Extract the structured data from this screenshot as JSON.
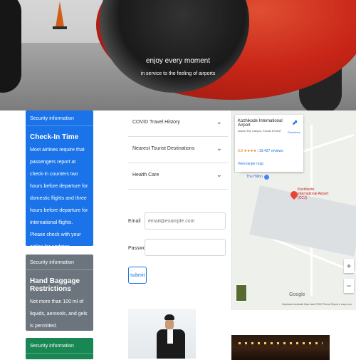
{
  "hero": {
    "headline": "enjoy every moment",
    "subline": "in service to the feeling of airports"
  },
  "cards": [
    {
      "header": "Security information",
      "title": "Check-In Time",
      "text": "Most airlines require that passengers report at check-in counters two hours before departure for domestic flights and three hours before departure for international flights. Please check with your airline for updates.",
      "color": "#1a73e8"
    },
    {
      "header": "Security information",
      "title": "Hand Baggage Restrictions",
      "text": "Not more than 100 ml of liquids, aerosols, and gels is permitted.",
      "color": "#6c757d"
    },
    {
      "header": "Security information",
      "color": "#198754"
    }
  ],
  "accordion": {
    "items": [
      {
        "label": "COVID Travel History"
      },
      {
        "label": "Nearest Tourist Destinations"
      },
      {
        "label": "Health Care"
      }
    ]
  },
  "form": {
    "email_label": "Email",
    "email_placeholder": "email@example.com",
    "password_label": "Password",
    "submit_label": "submit"
  },
  "map": {
    "place_name": "Kozhikode International Airport",
    "address": "Airport Rd, Karipur, Kerala 673647",
    "rating": "3.9 ★★★★☆",
    "reviews": "19,427 reviews",
    "directions_label": "Directions",
    "larger_map_label": "View larger map",
    "pin_label": "Kozhikode International Airport (CCJ)",
    "poi_label": "The Hilton",
    "zoom_in": "+",
    "zoom_out": "−",
    "google_label": "Google",
    "footer_text": "Keyboard shortcuts  Map data ©2023  Terms  Report a map error"
  },
  "colors": {
    "accent": "#1a73e8",
    "card_blue": "#1a73e8",
    "card_gray": "#6c757d",
    "card_green": "#198754"
  }
}
